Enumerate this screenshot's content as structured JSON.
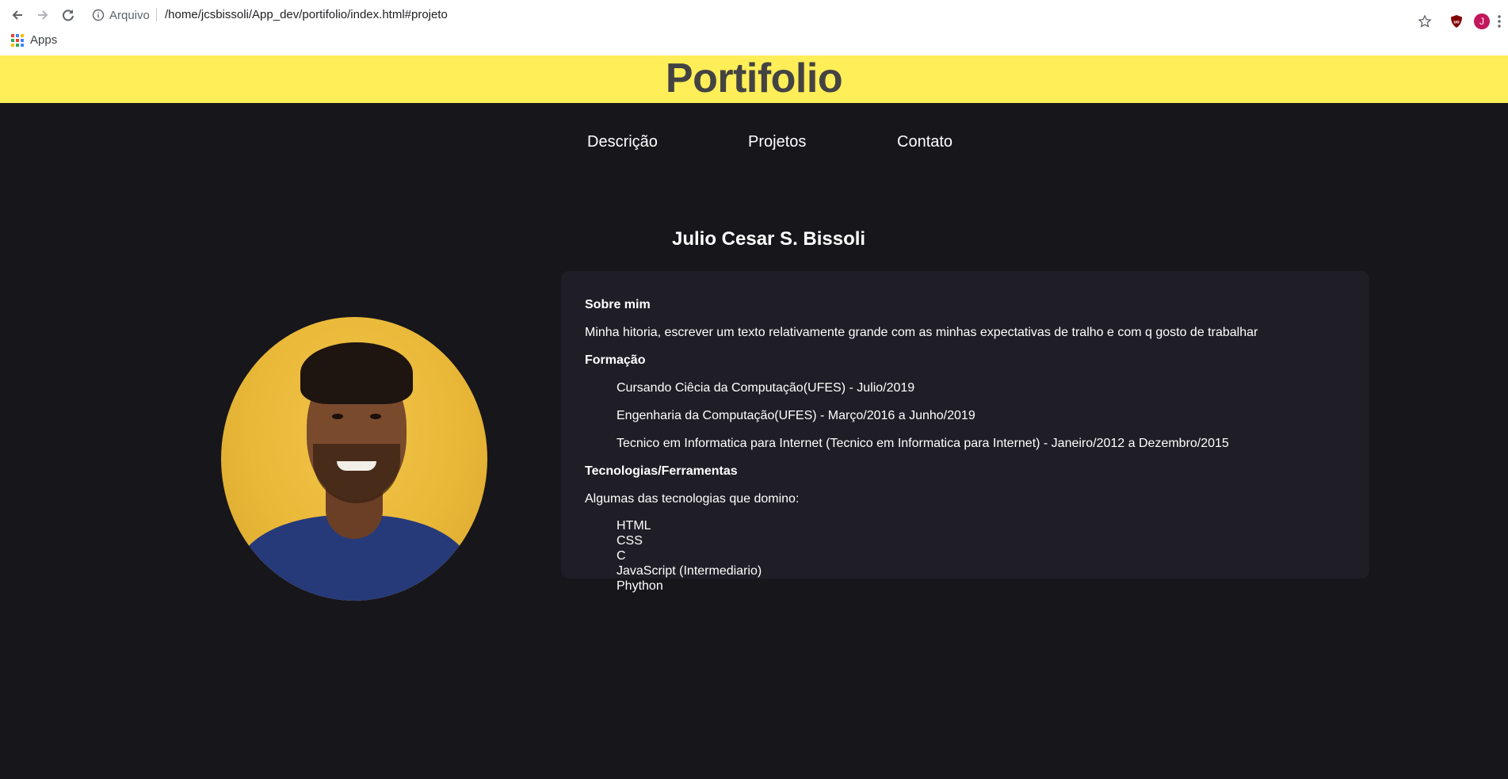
{
  "browser": {
    "info_label": "Arquivo",
    "url": "/home/jcsbissoli/App_dev/portifolio/index.html#projeto",
    "bookmarks_apps_label": "Apps",
    "profile_initial": "J",
    "extension_label": "uo"
  },
  "page": {
    "header_title": "Portifolio",
    "nav": [
      "Descrição",
      "Projetos",
      "Contato"
    ],
    "name": "Julio Cesar S. Bissoli",
    "about": {
      "heading": "Sobre mim",
      "text": "Minha hitoria, escrever um texto relativamente grande com as minhas expectativas de tralho e com q gosto de trabalhar"
    },
    "education": {
      "heading": "Formação",
      "items": [
        "Cursando Ciêcia da Computação(UFES) - Julio/2019",
        "Engenharia da Computação(UFES) - Março/2016 a Junho/2019",
        "Tecnico em Informatica para Internet (Tecnico em Informatica para Internet) - Janeiro/2012 a Dezembro/2015"
      ]
    },
    "tech": {
      "heading": "Tecnologias/Ferramentas",
      "intro": "Algumas das tecnologias que domino:",
      "items": [
        "HTML",
        "CSS",
        "C",
        "JavaScript (Intermediario)",
        "Phython"
      ]
    }
  },
  "colors": {
    "header_bg": "#ffee58",
    "page_bg": "#17161b",
    "card_bg": "#1f1e26",
    "title_text": "#434343"
  }
}
